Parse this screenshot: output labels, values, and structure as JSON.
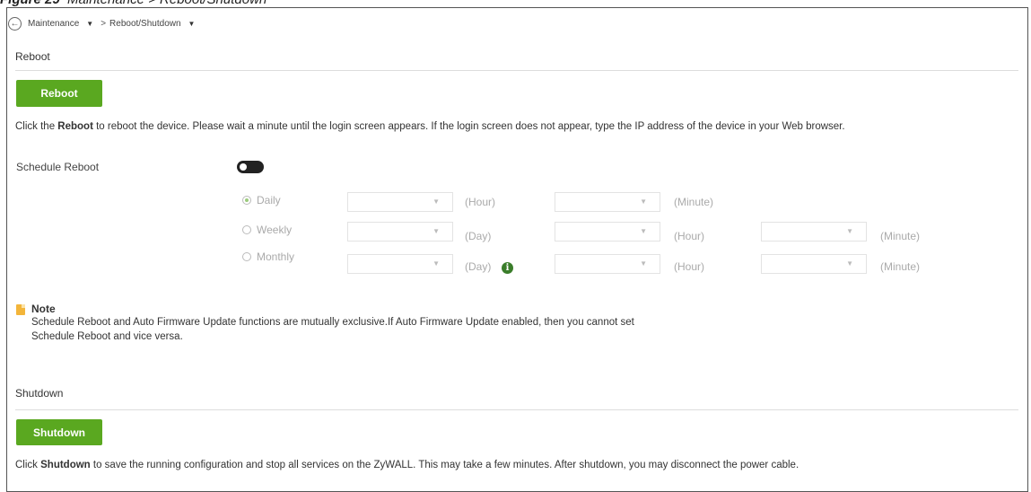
{
  "caption": {
    "label": "Figure 29",
    "text": "Maintenance > Reboot/Shutdown"
  },
  "breadcrumb": {
    "back_icon": "back-arrow-circle-icon",
    "items": [
      {
        "label": "Maintenance"
      },
      {
        "label": "Reboot/Shutdown"
      }
    ],
    "separator": ">"
  },
  "reboot": {
    "section_title": "Reboot",
    "button_label": "Reboot",
    "desc_prefix": "Click the ",
    "desc_bold": "Reboot",
    "desc_rest": " to reboot the device. Please wait a minute until the login screen appears. If the login screen does not appear, type the IP address of the device in your Web browser."
  },
  "schedule": {
    "label": "Schedule Reboot",
    "enabled": false,
    "options": [
      {
        "label": "Daily",
        "selected": true,
        "units": [
          "(Hour)",
          "(Minute)"
        ]
      },
      {
        "label": "Weekly",
        "selected": false,
        "units": [
          "(Day)",
          "(Hour)",
          "(Minute)"
        ]
      },
      {
        "label": "Monthly",
        "selected": false,
        "units": [
          "(Day)",
          "(Hour)",
          "(Minute)"
        ]
      }
    ]
  },
  "note": {
    "title": "Note",
    "line1": "Schedule Reboot and Auto Firmware Update functions are mutually exclusive.If Auto Firmware Update enabled, then you cannot set",
    "line2": "Schedule Reboot and vice versa."
  },
  "shutdown": {
    "section_title": "Shutdown",
    "button_label": "Shutdown",
    "desc_prefix": "Click ",
    "desc_bold": "Shutdown",
    "desc_rest": " to save the running configuration and stop all services on the ZyWALL. This may take a few minutes. After shutdown, you may disconnect the power cable."
  },
  "colors": {
    "accent_green": "#5aa820",
    "info_green": "#3a7d2a",
    "note_yellow": "#f3b53a"
  }
}
